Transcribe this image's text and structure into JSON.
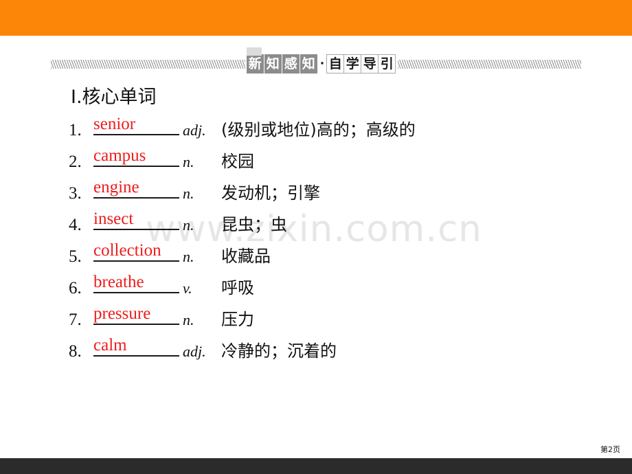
{
  "theme": {
    "top_band_color": "#fc8608",
    "bottom_band_color": "#2b2b2b",
    "word_color": "#ee1c1c",
    "banner_box_dark": "#8c8c8c",
    "watermark_color": "#e6e6e6"
  },
  "banner": {
    "dark_chars": [
      "新",
      "知",
      "感",
      "知"
    ],
    "separator": "·",
    "light_chars": [
      "自",
      "学",
      "导",
      "引"
    ],
    "full_text": "新知感知·自学导引"
  },
  "watermark": {
    "text": "www.zixin.com.cn"
  },
  "main": {
    "section_heading_numeral": "Ⅰ",
    "section_heading_text": ".核心单词",
    "words": [
      {
        "num": "1.",
        "word": "senior",
        "pos": "adj.",
        "meaning": "(级别或地位)高的；高级的"
      },
      {
        "num": "2.",
        "word": "campus",
        "pos": "n.",
        "meaning": "校园"
      },
      {
        "num": "3.",
        "word": "engine",
        "pos": "n.",
        "meaning": "发动机；引擎"
      },
      {
        "num": "4.",
        "word": "insect",
        "pos": "n.",
        "meaning": "昆虫；虫"
      },
      {
        "num": "5.",
        "word": "collection",
        "pos": "n.",
        "meaning": "收藏品"
      },
      {
        "num": "6.",
        "word": "breathe",
        "pos": "v.",
        "meaning": "呼吸"
      },
      {
        "num": "7.",
        "word": "pressure",
        "pos": "n.",
        "meaning": "压力"
      },
      {
        "num": "8.",
        "word": "calm",
        "pos": "adj.",
        "meaning": "冷静的；沉着的"
      }
    ]
  },
  "footer": {
    "page_label": "第2页"
  }
}
